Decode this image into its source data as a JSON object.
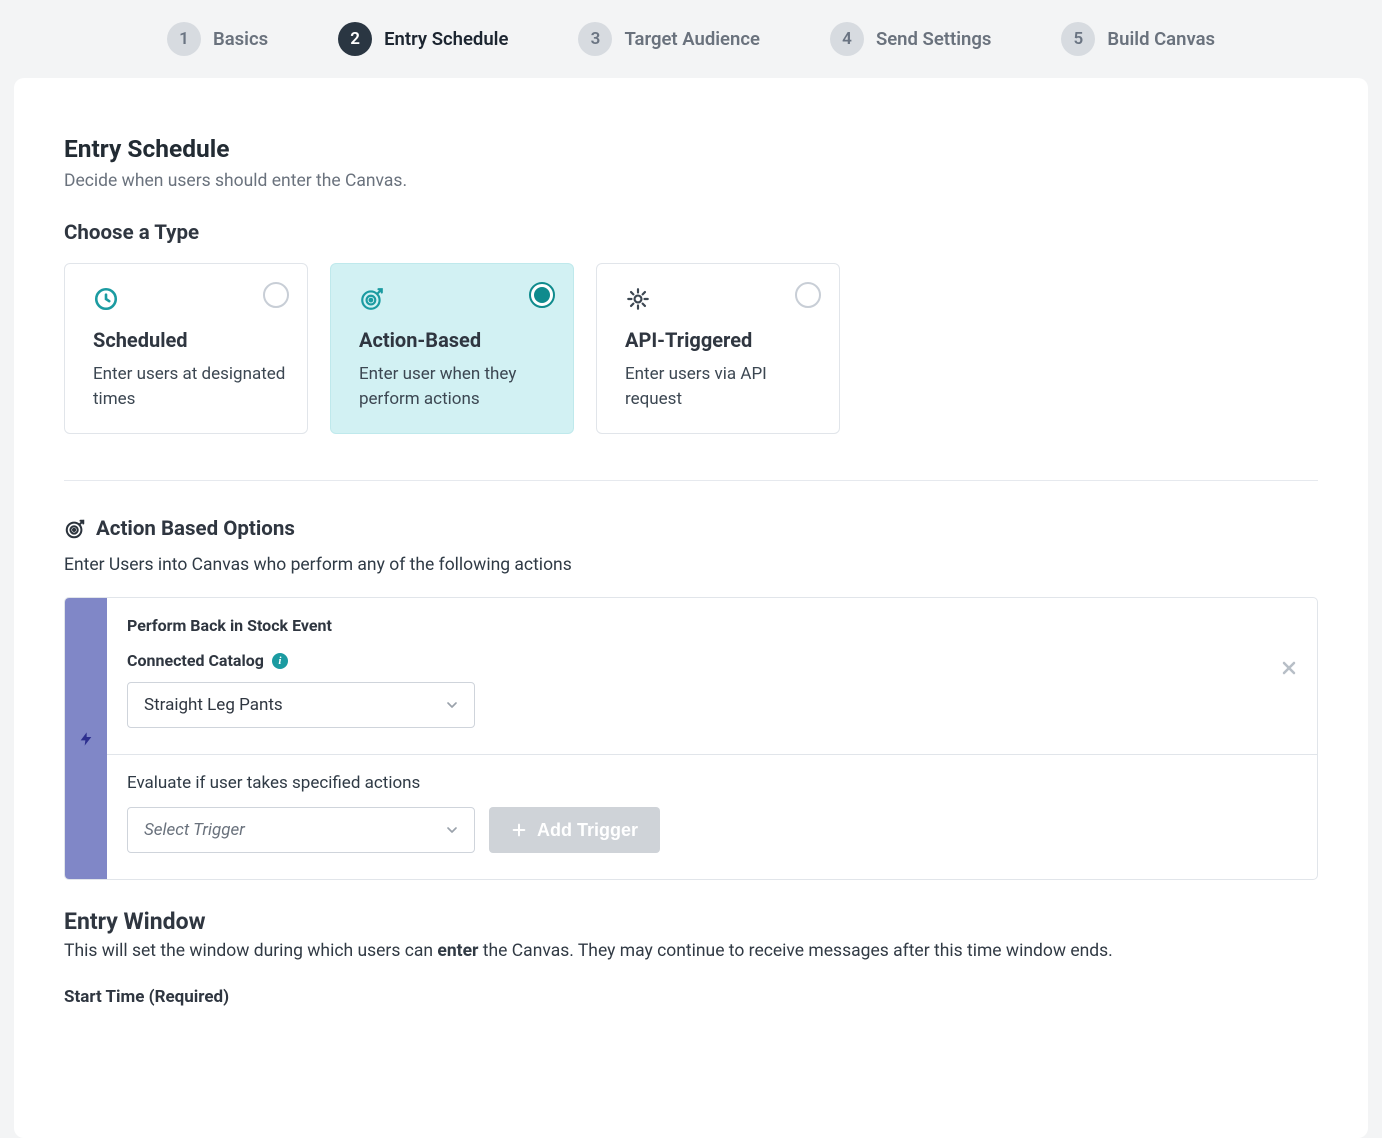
{
  "stepper": {
    "active_index": 1,
    "steps": [
      {
        "num": "1",
        "label": "Basics"
      },
      {
        "num": "2",
        "label": "Entry Schedule"
      },
      {
        "num": "3",
        "label": "Target Audience"
      },
      {
        "num": "4",
        "label": "Send Settings"
      },
      {
        "num": "5",
        "label": "Build Canvas"
      }
    ]
  },
  "page": {
    "title": "Entry Schedule",
    "subtitle": "Decide when users should enter the Canvas.",
    "choose_type_label": "Choose a Type"
  },
  "types": {
    "selected": "action",
    "scheduled": {
      "title": "Scheduled",
      "desc": "Enter users at designated times"
    },
    "action": {
      "title": "Action-Based",
      "desc": "Enter user when they perform actions"
    },
    "api": {
      "title": "API-Triggered",
      "desc": "Enter users via API request"
    }
  },
  "options": {
    "header": "Action Based Options",
    "sub": "Enter Users into Canvas who perform any of the following actions"
  },
  "event": {
    "title": "Perform Back in Stock Event",
    "catalog_label": "Connected Catalog",
    "catalog_value": "Straight Leg Pants",
    "evaluate_label": "Evaluate if user takes specified actions",
    "trigger_placeholder": "Select Trigger",
    "add_trigger_label": "Add Trigger"
  },
  "entry_window": {
    "title": "Entry Window",
    "desc_pre": "This will set the window during which users can ",
    "desc_bold": "enter",
    "desc_post": " the Canvas. They may continue to receive messages after this time window ends.",
    "start_time_label": "Start Time (Required)"
  }
}
